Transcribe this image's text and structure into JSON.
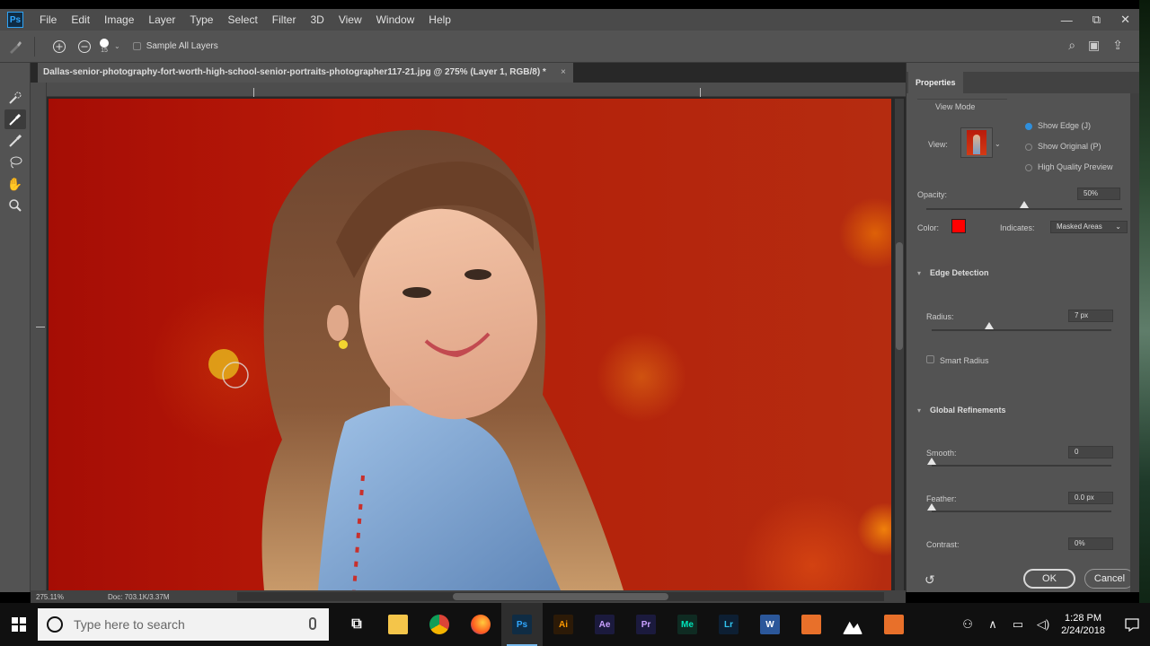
{
  "app": {
    "logo": "Ps"
  },
  "menu": [
    "File",
    "Edit",
    "Image",
    "Layer",
    "Type",
    "Select",
    "Filter",
    "3D",
    "View",
    "Window",
    "Help"
  ],
  "window_controls": {
    "minimize": "—",
    "restore": "⧉",
    "close": "✕"
  },
  "options_bar": {
    "brush_size": "15",
    "sample_all_layers": "Sample All Layers",
    "sample_all_layers_checked": false
  },
  "document": {
    "tab_title": "Dallas-senior-photography-fort-worth-high-school-senior-portraits-photographer117-21.jpg @ 275% (Layer 1, RGB/8) *",
    "close": "×",
    "zoom_status": "275.11%",
    "doc_status": "Doc: 703.1K/3.37M"
  },
  "properties": {
    "tab": "Properties",
    "view_mode": {
      "heading": "View Mode",
      "view_label": "View:",
      "show_edge": "Show Edge (J)",
      "show_original": "Show Original (P)",
      "high_quality_preview": "High Quality Preview",
      "selected": "show_edge"
    },
    "opacity": {
      "label": "Opacity:",
      "value": "50%",
      "level": 0.5
    },
    "color": {
      "label": "Color:",
      "swatch": "#ff0000"
    },
    "indicates": {
      "label": "Indicates:",
      "value": "Masked Areas"
    },
    "edge_detection": {
      "heading": "Edge Detection",
      "radius_label": "Radius:",
      "radius_value": "7 px",
      "radius_level": 0.32,
      "smart_radius": "Smart Radius"
    },
    "global_refinements": {
      "heading": "Global Refinements",
      "smooth_label": "Smooth:",
      "smooth_value": "0",
      "feather_label": "Feather:",
      "feather_value": "0.0 px",
      "contrast_label": "Contrast:",
      "contrast_value": "0%"
    },
    "ok": "OK",
    "cancel": "Cancel"
  },
  "taskbar": {
    "search_placeholder": "Type here to search",
    "apps": [
      {
        "name": "task-view",
        "label": "⧉",
        "bg": "transparent",
        "fg": "#ffffff"
      },
      {
        "name": "file-explorer",
        "label": "",
        "bg": "#f4c54a",
        "fg": "#000000"
      },
      {
        "name": "chrome",
        "label": "",
        "bg": "transparent",
        "fg": "#ffffff"
      },
      {
        "name": "firefox",
        "label": "",
        "bg": "transparent",
        "fg": "#ffffff"
      },
      {
        "name": "photoshop",
        "label": "Ps",
        "bg": "#0f2c44",
        "fg": "#31a8ff"
      },
      {
        "name": "illustrator",
        "label": "Ai",
        "bg": "#2c1a07",
        "fg": "#ff9a00"
      },
      {
        "name": "after-effects",
        "label": "Ae",
        "bg": "#1b1a3d",
        "fg": "#c8a0ff"
      },
      {
        "name": "premiere",
        "label": "Pr",
        "bg": "#1b1a3d",
        "fg": "#c8a0ff"
      },
      {
        "name": "media-encoder",
        "label": "Me",
        "bg": "#0f2b22",
        "fg": "#00e4bb"
      },
      {
        "name": "lightroom",
        "label": "Lr",
        "bg": "#0d1f33",
        "fg": "#31c5f0"
      },
      {
        "name": "word",
        "label": "W",
        "bg": "#2b579a",
        "fg": "#ffffff"
      },
      {
        "name": "app-orange-1",
        "label": "",
        "bg": "#e8702a",
        "fg": "#ffffff"
      },
      {
        "name": "photos",
        "label": "",
        "bg": "transparent",
        "fg": "#ffffff"
      },
      {
        "name": "app-orange-2",
        "label": "",
        "bg": "#e8702a",
        "fg": "#ffffff"
      }
    ],
    "time": "1:28 PM",
    "date": "2/24/2018"
  }
}
